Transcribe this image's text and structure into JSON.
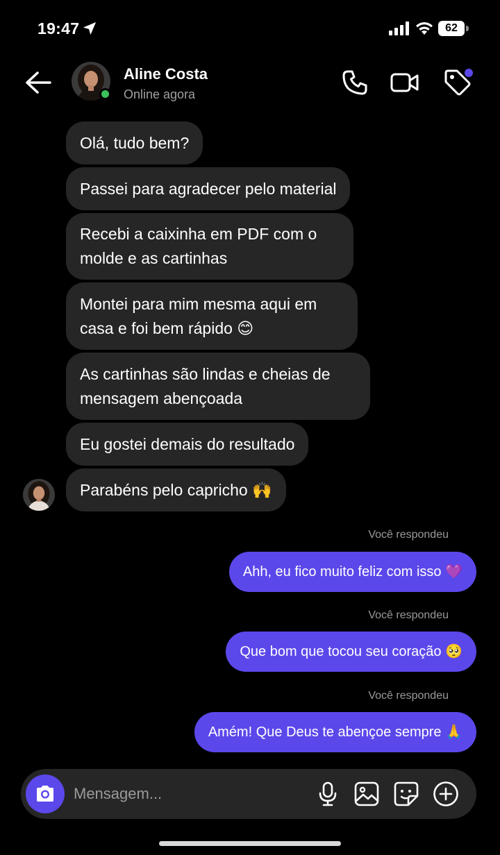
{
  "status_bar": {
    "time": "19:47",
    "battery": "62"
  },
  "header": {
    "contact_name": "Aline Costa",
    "contact_status": "Online agora"
  },
  "messages_in": [
    {
      "text": "Olá, tudo bem?"
    },
    {
      "text": "Passei para agradecer pelo material"
    },
    {
      "text": "Recebi a caixinha em PDF com o molde e as cartinhas"
    },
    {
      "text": "Montei para mim mesma aqui em casa e foi bem rápido 😊"
    },
    {
      "text": "As cartinhas são lindas e cheias de mensagem abençoada"
    },
    {
      "text": "Eu gostei demais do resultado"
    },
    {
      "text": "Parabéns pelo capricho 🙌"
    }
  ],
  "messages_out": [
    {
      "label": "Você respondeu",
      "text": "Ahh, eu fico muito feliz com isso 💜"
    },
    {
      "label": "Você respondeu",
      "text": "Que bom que tocou seu coração 🥺"
    },
    {
      "label": "Você respondeu",
      "text": "Amém! Que Deus te abençoe sempre 🙏"
    }
  ],
  "composer": {
    "placeholder": "Mensagem..."
  },
  "colors": {
    "accent": "#5b48ea",
    "incoming_bubble": "#262626",
    "online": "#3ac25b"
  }
}
